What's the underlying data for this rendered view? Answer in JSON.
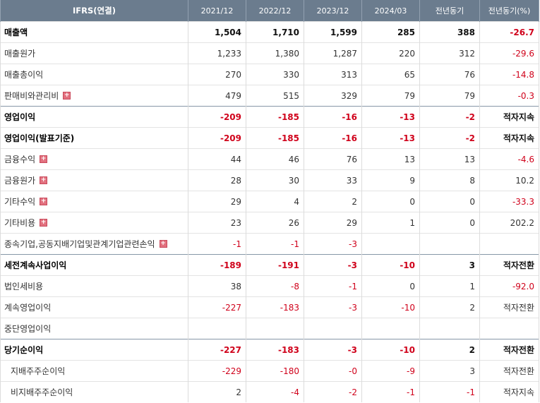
{
  "header": {
    "row_label": "IFRS(연결)",
    "columns": [
      "2021/12",
      "2022/12",
      "2023/12",
      "2024/03",
      "전년동기",
      "전년동기(%)"
    ]
  },
  "rows": [
    {
      "label": "매출액",
      "values": [
        "1,504",
        "1,710",
        "1,599",
        "285",
        "388",
        "-26.7"
      ]
    },
    {
      "label": "매출원가",
      "values": [
        "1,233",
        "1,380",
        "1,287",
        "220",
        "312",
        "-29.6"
      ]
    },
    {
      "label": "매출총이익",
      "values": [
        "270",
        "330",
        "313",
        "65",
        "76",
        "-14.8"
      ]
    },
    {
      "label": "판매비와관리비",
      "values": [
        "479",
        "515",
        "329",
        "79",
        "79",
        "-0.3"
      ]
    },
    {
      "label": "영업이익",
      "values": [
        "-209",
        "-185",
        "-16",
        "-13",
        "-2",
        "적자지속"
      ]
    },
    {
      "label": "영업이익(발표기준)",
      "values": [
        "-209",
        "-185",
        "-16",
        "-13",
        "-2",
        "적자지속"
      ]
    },
    {
      "label": "금융수익",
      "values": [
        "44",
        "46",
        "76",
        "13",
        "13",
        "-4.6"
      ]
    },
    {
      "label": "금융원가",
      "values": [
        "28",
        "30",
        "33",
        "9",
        "8",
        "10.2"
      ]
    },
    {
      "label": "기타수익",
      "values": [
        "29",
        "4",
        "2",
        "0",
        "0",
        "-33.3"
      ]
    },
    {
      "label": "기타비용",
      "values": [
        "23",
        "26",
        "29",
        "1",
        "0",
        "202.2"
      ]
    },
    {
      "label": "종속기업,공동지배기업및관계기업관련손익",
      "values": [
        "-1",
        "-1",
        "-3",
        "",
        "",
        ""
      ]
    },
    {
      "label": "세전계속사업이익",
      "values": [
        "-189",
        "-191",
        "-3",
        "-10",
        "3",
        "적자전환"
      ]
    },
    {
      "label": "법인세비용",
      "values": [
        "38",
        "-8",
        "-1",
        "0",
        "1",
        "-92.0"
      ]
    },
    {
      "label": "계속영업이익",
      "values": [
        "-227",
        "-183",
        "-3",
        "-10",
        "2",
        "적자전환"
      ]
    },
    {
      "label": "중단영업이익",
      "values": [
        "",
        "",
        "",
        "",
        "",
        ""
      ]
    },
    {
      "label": "당기순이익",
      "values": [
        "-227",
        "-183",
        "-3",
        "-10",
        "2",
        "적자전환"
      ]
    },
    {
      "label": "지배주주순이익",
      "values": [
        "-229",
        "-180",
        "-0",
        "-9",
        "3",
        "적자전환"
      ]
    },
    {
      "label": "비지배주주순이익",
      "values": [
        "2",
        "-4",
        "-2",
        "-1",
        "-1",
        "적자지속"
      ]
    }
  ],
  "expand_icon_symbol": "+"
}
